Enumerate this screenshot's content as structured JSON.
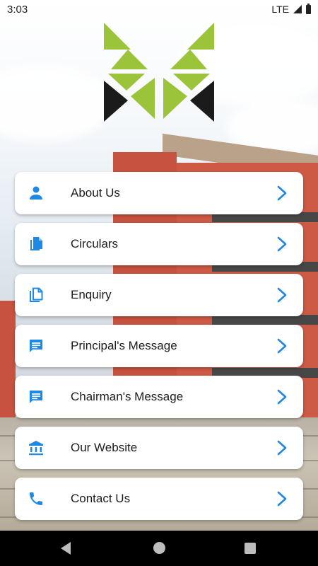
{
  "status_bar": {
    "time": "3:03",
    "network": "LTE"
  },
  "menu": {
    "items": [
      {
        "label": "About Us",
        "icon": "person-icon"
      },
      {
        "label": "Circulars",
        "icon": "file-copy-icon"
      },
      {
        "label": "Enquiry",
        "icon": "file-copy-outline-icon"
      },
      {
        "label": "Principal's Message",
        "icon": "message-icon"
      },
      {
        "label": "Chairman's Message",
        "icon": "message-icon"
      },
      {
        "label": "Our Website",
        "icon": "institution-icon"
      },
      {
        "label": "Contact Us",
        "icon": "phone-icon"
      }
    ]
  },
  "colors": {
    "accent": "#1e88e5",
    "logo_green": "#9cc43a",
    "logo_black": "#1b1b1b"
  }
}
